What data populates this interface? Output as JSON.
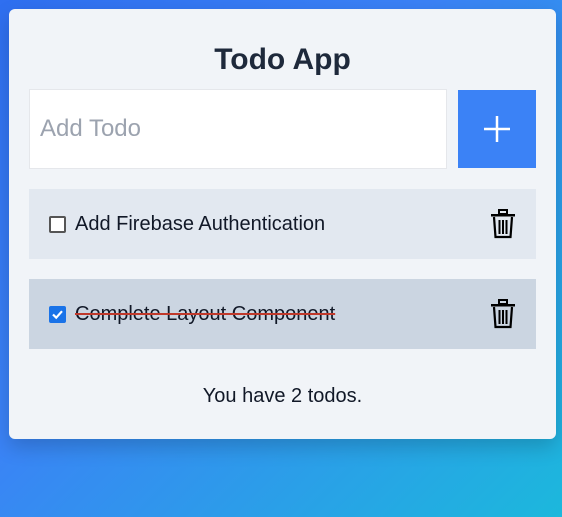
{
  "app": {
    "title": "Todo App"
  },
  "add_form": {
    "placeholder": "Add Todo",
    "value": "",
    "button_icon": "plus-icon"
  },
  "todos": [
    {
      "text": "Add Firebase Authentication",
      "completed": false,
      "background": "#e2e8f0"
    },
    {
      "text": "Complete Layout Component",
      "completed": true,
      "background": "#cbd5e1"
    }
  ],
  "footer": {
    "summary": "You have 2 todos."
  },
  "colors": {
    "accent": "#3b82f6",
    "card": "#f1f4f8",
    "strike": "#c0392b"
  }
}
